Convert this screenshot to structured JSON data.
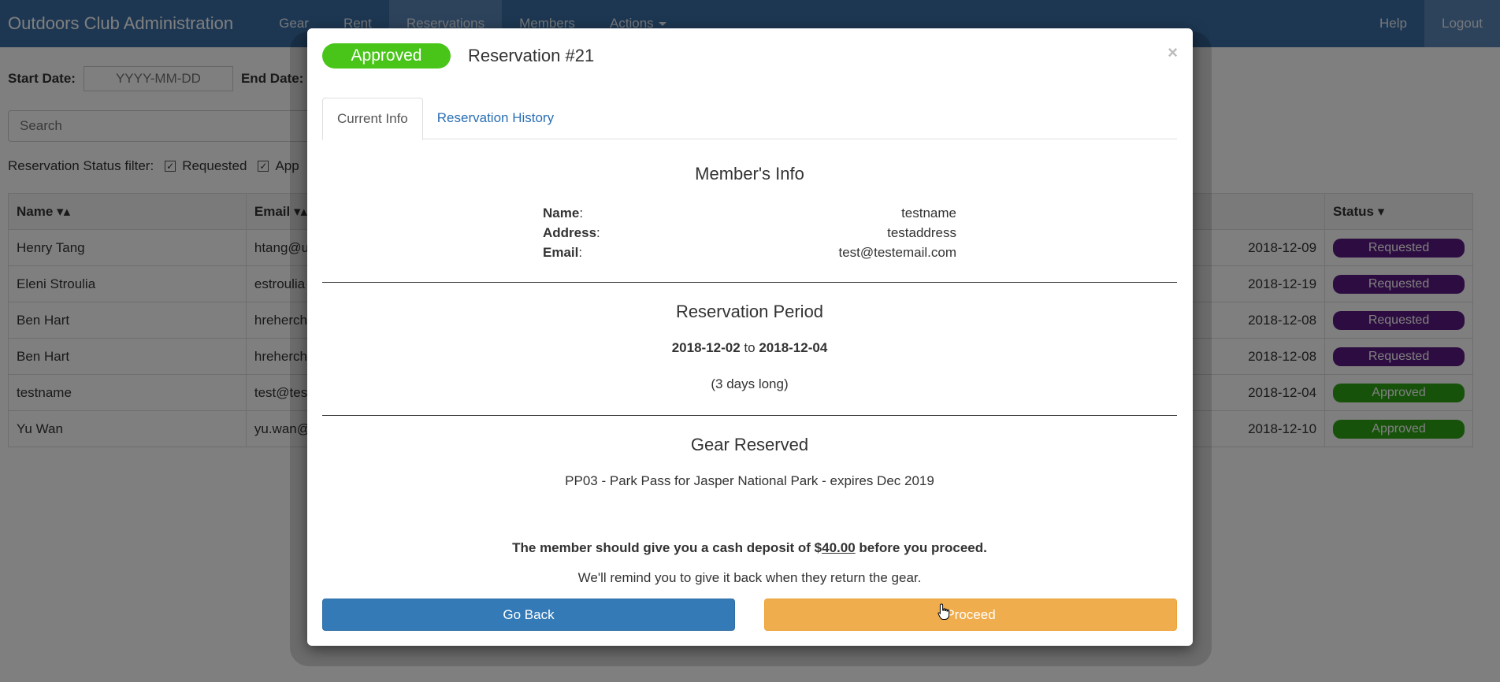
{
  "navbar": {
    "brand": "Outdoors Club Administration",
    "items": [
      "Gear",
      "Rent",
      "Reservations",
      "Members",
      "Actions"
    ],
    "right_items": [
      "Help",
      "Logout"
    ]
  },
  "filters": {
    "start_label": "Start Date:",
    "start_placeholder": "YYYY-MM-DD",
    "end_label": "End Date:",
    "search_placeholder": "Search",
    "status_label": "Reservation Status filter:",
    "status_options": [
      "Requested",
      "App"
    ]
  },
  "table": {
    "headers": {
      "name": "Name",
      "email": "Email",
      "status": "Status"
    },
    "rows": [
      {
        "name": "Henry Tang",
        "email": "htang@u",
        "end": "2018-12-09",
        "status": "Requested"
      },
      {
        "name": "Eleni Stroulia",
        "email": "estroulia",
        "end": "2018-12-19",
        "status": "Requested"
      },
      {
        "name": "Ben Hart",
        "email": "hreherch",
        "end": "2018-12-08",
        "status": "Requested"
      },
      {
        "name": "Ben Hart",
        "email": "hreherch",
        "end": "2018-12-08",
        "status": "Requested"
      },
      {
        "name": "testname",
        "email": "test@tes",
        "end": "2018-12-04",
        "status": "Approved"
      },
      {
        "name": "Yu Wan",
        "email": "yu.wan@",
        "end": "2018-12-10",
        "status": "Approved"
      }
    ]
  },
  "modal": {
    "status_badge": "Approved",
    "title": "Reservation #21",
    "close": "×",
    "tabs": [
      "Current Info",
      "Reservation History"
    ],
    "member_section": "Member's Info",
    "member": {
      "name_label": "Name",
      "name": "testname",
      "address_label": "Address",
      "address": "testaddress",
      "email_label": "Email",
      "email": "test@testemail.com"
    },
    "period_section": "Reservation Period",
    "period": {
      "start": "2018-12-02",
      "to": "to",
      "end": "2018-12-04",
      "length": "(3 days long)"
    },
    "gear_section": "Gear Reserved",
    "gear_item": "PP03 - Park Pass for Jasper National Park - expires Dec 2019",
    "deposit": {
      "prefix": "The member should give you a cash deposit of $",
      "amount": "40.00",
      "suffix": "before you proceed.",
      "reminder": "We'll remind you to give it back when they return the gear."
    },
    "buttons": {
      "back": "Go Back",
      "proceed": "Proceed"
    }
  },
  "colors": {
    "navbar": "#3a6ea5",
    "approved": "#49c51a",
    "requested": "#5b1a82",
    "primary": "#337ab7",
    "warning": "#f0ad4e"
  }
}
